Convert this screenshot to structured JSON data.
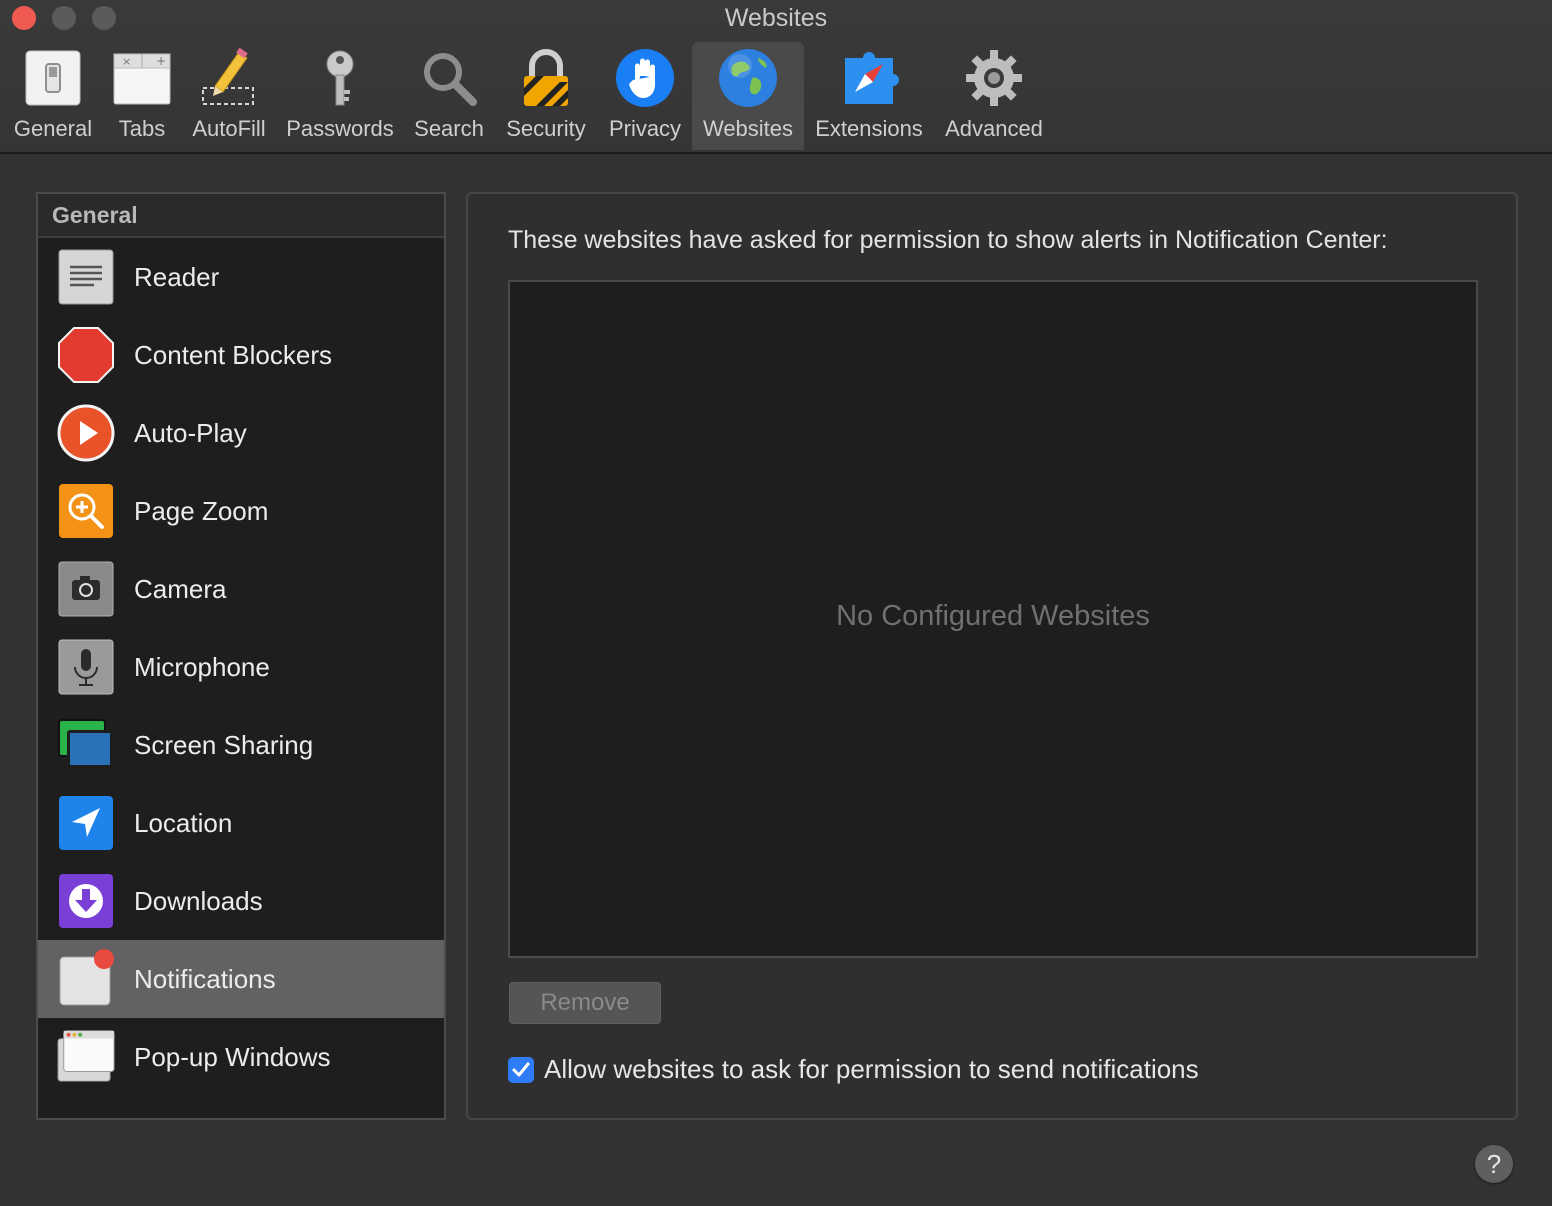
{
  "window": {
    "title": "Websites"
  },
  "toolbar": {
    "items": [
      {
        "label": "General",
        "icon": "general-switch-icon"
      },
      {
        "label": "Tabs",
        "icon": "tabs-icon"
      },
      {
        "label": "AutoFill",
        "icon": "autofill-pencil-icon"
      },
      {
        "label": "Passwords",
        "icon": "key-icon"
      },
      {
        "label": "Search",
        "icon": "magnifier-icon"
      },
      {
        "label": "Security",
        "icon": "padlock-icon"
      },
      {
        "label": "Privacy",
        "icon": "hand-icon"
      },
      {
        "label": "Websites",
        "icon": "globe-icon",
        "selected": true
      },
      {
        "label": "Extensions",
        "icon": "puzzle-compass-icon"
      },
      {
        "label": "Advanced",
        "icon": "gear-icon"
      }
    ]
  },
  "sidebar": {
    "header": "General",
    "items": [
      {
        "label": "Reader",
        "icon": "reader-icon"
      },
      {
        "label": "Content Blockers",
        "icon": "stop-sign-icon"
      },
      {
        "label": "Auto-Play",
        "icon": "play-icon"
      },
      {
        "label": "Page Zoom",
        "icon": "zoom-icon"
      },
      {
        "label": "Camera",
        "icon": "camera-icon"
      },
      {
        "label": "Microphone",
        "icon": "microphone-icon"
      },
      {
        "label": "Screen Sharing",
        "icon": "screen-sharing-icon"
      },
      {
        "label": "Location",
        "icon": "location-arrow-icon"
      },
      {
        "label": "Downloads",
        "icon": "download-icon"
      },
      {
        "label": "Notifications",
        "icon": "notification-badge-icon",
        "selected": true
      },
      {
        "label": "Pop-up Windows",
        "icon": "popup-windows-icon"
      }
    ]
  },
  "main": {
    "heading": "These websites have asked for permission to show alerts in Notification Center:",
    "empty_message": "No Configured Websites",
    "remove_label": "Remove",
    "allow_label": "Allow websites to ask for permission to send notifications",
    "allow_checked": true
  },
  "help": {
    "label": "?"
  },
  "colors": {
    "accent": "#2f7df6",
    "close": "#ee5a52",
    "selected_row": "#626262"
  }
}
